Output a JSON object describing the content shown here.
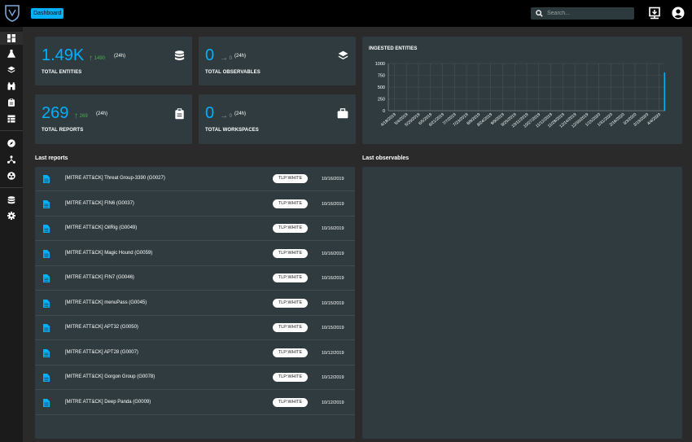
{
  "topbar": {
    "breadcrumb": "Dashboard",
    "search_placeholder": "Search..."
  },
  "sidebar": {
    "items": [
      "dashboard-icon",
      "flask-icon",
      "layers-icon",
      "binoculars-icon",
      "clipboard-icon",
      "table-icon",
      "compass-icon",
      "graph-icon",
      "biohazard-icon",
      "database-icon",
      "settings-icon"
    ]
  },
  "cards": {
    "entities": {
      "value": "1.49K",
      "delta": "1490",
      "period": "(24h)",
      "label": "TOTAL ENTITIES"
    },
    "observables": {
      "value": "0",
      "delta": "0",
      "period": "(24h)",
      "label": "TOTAL OBSERVABLES"
    },
    "reports": {
      "value": "269",
      "delta": "269",
      "period": "(24h)",
      "label": "TOTAL REPORTS"
    },
    "workspaces": {
      "value": "0",
      "delta": "0",
      "period": "(24h)",
      "label": "TOTAL WORKSPACES"
    }
  },
  "chart": {
    "title": "INGESTED ENTITIES"
  },
  "chart_data": {
    "type": "bar",
    "title": "INGESTED ENTITIES",
    "ylim": [
      0,
      1000
    ],
    "yticks": [
      "1000",
      "750",
      "500",
      "250",
      "0"
    ],
    "categories": [
      "4/18/2019",
      "5/4/2019",
      "5/20/2019",
      "6/5/2019",
      "6/21/2019",
      "7/7/2019",
      "7/23/2019",
      "8/8/2019",
      "8/24/2019",
      "9/9/2019",
      "9/25/2019",
      "10/11/2019",
      "10/27/2019",
      "11/12/2019",
      "11/28/2019",
      "12/14/2019",
      "12/30/2019",
      "1/15/2020",
      "1/31/2020",
      "2/16/2020",
      "3/3/2020",
      "3/19/2020",
      "4/4/2020"
    ],
    "values": [
      0,
      0,
      0,
      0,
      0,
      0,
      0,
      0,
      0,
      0,
      0,
      0,
      0,
      0,
      0,
      0,
      0,
      0,
      0,
      0,
      0,
      0,
      810
    ],
    "grid": true,
    "color": "#00b1ff"
  },
  "reports": {
    "title": "Last reports",
    "rows": [
      {
        "name": "[MITRE ATT&CK] Threat Group-3390 (G0027)",
        "marking": "TLP:WHITE",
        "date": "10/16/2019"
      },
      {
        "name": "[MITRE ATT&CK] FIN6 (G0037)",
        "marking": "TLP:WHITE",
        "date": "10/16/2019"
      },
      {
        "name": "[MITRE ATT&CK] OilRig (G0049)",
        "marking": "TLP:WHITE",
        "date": "10/16/2019"
      },
      {
        "name": "[MITRE ATT&CK] Magic Hound (G0059)",
        "marking": "TLP:WHITE",
        "date": "10/16/2019"
      },
      {
        "name": "[MITRE ATT&CK] FIN7 (G0046)",
        "marking": "TLP:WHITE",
        "date": "10/16/2019"
      },
      {
        "name": "[MITRE ATT&CK] menuPass (G0045)",
        "marking": "TLP:WHITE",
        "date": "10/15/2019"
      },
      {
        "name": "[MITRE ATT&CK] APT32 (G0050)",
        "marking": "TLP:WHITE",
        "date": "10/15/2019"
      },
      {
        "name": "[MITRE ATT&CK] APT28 (G0007)",
        "marking": "TLP:WHITE",
        "date": "10/12/2019"
      },
      {
        "name": "[MITRE ATT&CK] Gorgon Group (G0078)",
        "marking": "TLP:WHITE",
        "date": "10/12/2019"
      },
      {
        "name": "[MITRE ATT&CK] Deep Panda (G0009)",
        "marking": "TLP:WHITE",
        "date": "10/12/2019"
      }
    ]
  },
  "observables": {
    "title": "Last observables"
  },
  "colors": {
    "accent": "#00b1ff",
    "positive": "#4caf50",
    "card": "#2f3b3e"
  }
}
